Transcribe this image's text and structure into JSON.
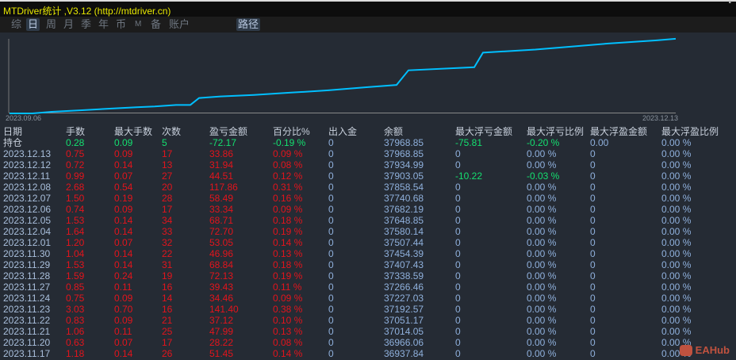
{
  "title": "MTDriver统计 ,V3.12 (http://mtdriver.cn)",
  "tabs": [
    {
      "label": "综",
      "active": false
    },
    {
      "label": "日",
      "active": true
    },
    {
      "label": "周",
      "active": false
    },
    {
      "label": "月",
      "active": false
    },
    {
      "label": "季",
      "active": false
    },
    {
      "label": "年",
      "active": false
    },
    {
      "label": "币",
      "active": false
    },
    {
      "label": "M",
      "active": false
    },
    {
      "label": "备",
      "active": false
    },
    {
      "label": "账户",
      "active": false
    },
    {
      "label": "路径",
      "active": true
    }
  ],
  "chart_data": {
    "type": "line",
    "x_start": "2023.09.06",
    "x_end": "2023.12.13",
    "line_color": "#00bfff",
    "relative_values": [
      0,
      0,
      2,
      4,
      6,
      8,
      9,
      11,
      11,
      20,
      22,
      24,
      27,
      30,
      34,
      37,
      56,
      60,
      79,
      83,
      86,
      91,
      95,
      97
    ]
  },
  "table": {
    "headers": [
      "日期",
      "手数",
      "最大手数",
      "次数",
      "盈亏金额",
      "百分比%",
      "出入金",
      "余额",
      "最大浮亏金额",
      "最大浮亏比例",
      "最大浮盈金额",
      "最大浮盈比例"
    ],
    "holding": [
      "持仓",
      "0.28",
      "0.09",
      "5",
      "-72.17",
      "-0.19 %",
      "0",
      "37968.85",
      "-75.81",
      "-0.20 %",
      "0.00",
      "0.00 %"
    ],
    "rows": [
      [
        "2023.12.13",
        "0.75",
        "0.09",
        "17",
        "33.86",
        "0.09 %",
        "0",
        "37968.85",
        "0",
        "0.00 %",
        "0",
        "0.00 %"
      ],
      [
        "2023.12.12",
        "0.72",
        "0.14",
        "13",
        "31.94",
        "0.08 %",
        "0",
        "37934.99",
        "0",
        "0.00 %",
        "0",
        "0.00 %"
      ],
      [
        "2023.12.11",
        "0.99",
        "0.07",
        "27",
        "44.51",
        "0.12 %",
        "0",
        "37903.05",
        "-10.22",
        "-0.03 %",
        "0",
        "0.00 %"
      ],
      [
        "2023.12.08",
        "2.68",
        "0.54",
        "20",
        "117.86",
        "0.31 %",
        "0",
        "37858.54",
        "0",
        "0.00 %",
        "0",
        "0.00 %"
      ],
      [
        "2023.12.07",
        "1.50",
        "0.19",
        "28",
        "58.49",
        "0.16 %",
        "0",
        "37740.68",
        "0",
        "0.00 %",
        "0",
        "0.00 %"
      ],
      [
        "2023.12.06",
        "0.74",
        "0.09",
        "17",
        "33.34",
        "0.09 %",
        "0",
        "37682.19",
        "0",
        "0.00 %",
        "0",
        "0.00 %"
      ],
      [
        "2023.12.05",
        "1.53",
        "0.14",
        "34",
        "68.71",
        "0.18 %",
        "0",
        "37648.85",
        "0",
        "0.00 %",
        "0",
        "0.00 %"
      ],
      [
        "2023.12.04",
        "1.64",
        "0.14",
        "33",
        "72.70",
        "0.19 %",
        "0",
        "37580.14",
        "0",
        "0.00 %",
        "0",
        "0.00 %"
      ],
      [
        "2023.12.01",
        "1.20",
        "0.07",
        "32",
        "53.05",
        "0.14 %",
        "0",
        "37507.44",
        "0",
        "0.00 %",
        "0",
        "0.00 %"
      ],
      [
        "2023.11.30",
        "1.04",
        "0.14",
        "22",
        "46.96",
        "0.13 %",
        "0",
        "37454.39",
        "0",
        "0.00 %",
        "0",
        "0.00 %"
      ],
      [
        "2023.11.29",
        "1.53",
        "0.14",
        "31",
        "68.84",
        "0.18 %",
        "0",
        "37407.43",
        "0",
        "0.00 %",
        "0",
        "0.00 %"
      ],
      [
        "2023.11.28",
        "1.59",
        "0.24",
        "19",
        "72.13",
        "0.19 %",
        "0",
        "37338.59",
        "0",
        "0.00 %",
        "0",
        "0.00 %"
      ],
      [
        "2023.11.27",
        "0.85",
        "0.11",
        "16",
        "39.43",
        "0.11 %",
        "0",
        "37266.46",
        "0",
        "0.00 %",
        "0",
        "0.00 %"
      ],
      [
        "2023.11.24",
        "0.75",
        "0.09",
        "14",
        "34.46",
        "0.09 %",
        "0",
        "37227.03",
        "0",
        "0.00 %",
        "0",
        "0.00 %"
      ],
      [
        "2023.11.23",
        "3.03",
        "0.70",
        "16",
        "141.40",
        "0.38 %",
        "0",
        "37192.57",
        "0",
        "0.00 %",
        "0",
        "0.00 %"
      ],
      [
        "2023.11.22",
        "0.83",
        "0.09",
        "21",
        "37.12",
        "0.10 %",
        "0",
        "37051.17",
        "0",
        "0.00 %",
        "0",
        "0.00 %"
      ],
      [
        "2023.11.21",
        "1.06",
        "0.11",
        "25",
        "47.99",
        "0.13 %",
        "0",
        "37014.05",
        "0",
        "0.00 %",
        "0",
        "0.00 %"
      ],
      [
        "2023.11.20",
        "0.63",
        "0.07",
        "17",
        "28.22",
        "0.08 %",
        "0",
        "36966.06",
        "0",
        "0.00 %",
        "0",
        "0.00 %"
      ],
      [
        "2023.11.17",
        "1.18",
        "0.14",
        "26",
        "51.45",
        "0.14 %",
        "0",
        "36937.84",
        "0",
        "0.00 %",
        "0",
        "0.00 %"
      ]
    ]
  },
  "watermark": "EAHub",
  "colors": {
    "profit": "#e3141c",
    "holding": "#14e070",
    "date": "#a9bfdc",
    "value": "#8fb0dc"
  }
}
